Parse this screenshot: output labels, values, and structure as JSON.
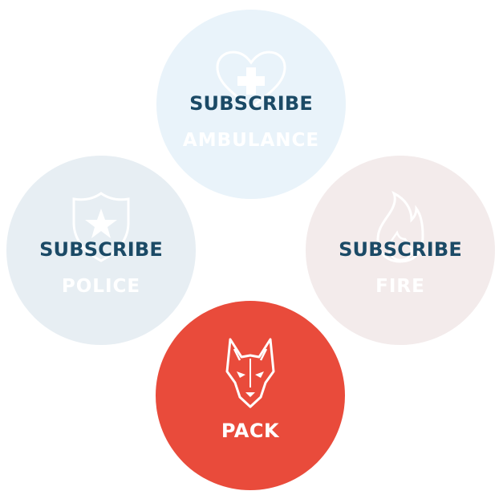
{
  "colors": {
    "text_dark": "#1b4a66",
    "ambulance_bg": "#e9f3fa",
    "police_bg": "#e7eef3",
    "fire_bg": "#f3ebeb",
    "pack_bg": "#e94b3b"
  },
  "tiles": {
    "ambulance": {
      "action": "SUBSCRIBE",
      "label": "AMBULANCE",
      "icon": "heart-plus-icon"
    },
    "police": {
      "action": "SUBSCRIBE",
      "label": "POLICE",
      "icon": "badge-star-icon"
    },
    "fire": {
      "action": "SUBSCRIBE",
      "label": "FIRE",
      "icon": "flame-icon"
    },
    "pack": {
      "label": "PACK",
      "icon": "wolf-icon"
    }
  }
}
